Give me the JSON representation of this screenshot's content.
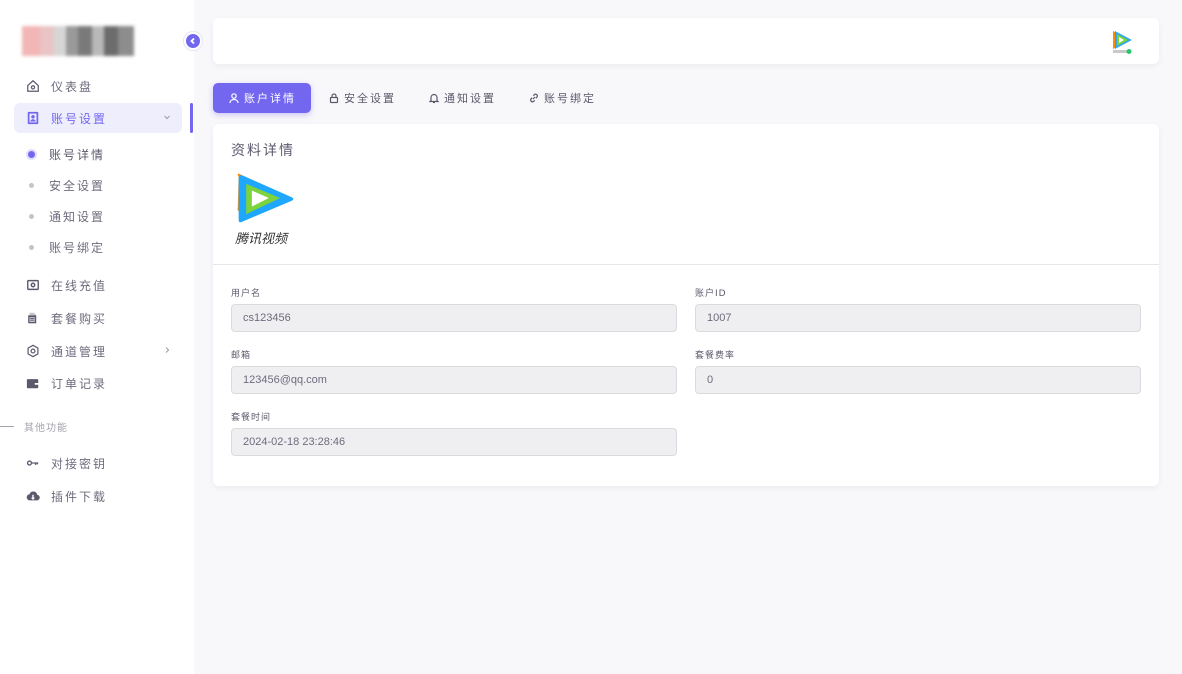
{
  "sidebar": {
    "nav": [
      {
        "label": "仪表盘",
        "icon": "home-icon"
      },
      {
        "label": "账号设置",
        "icon": "account-icon"
      },
      {
        "label": "在线充值",
        "icon": "recharge-icon"
      },
      {
        "label": "套餐购买",
        "icon": "package-icon"
      },
      {
        "label": "通道管理",
        "icon": "settings-icon"
      },
      {
        "label": "订单记录",
        "icon": "wallet-icon"
      }
    ],
    "sub": [
      {
        "label": "账号详情"
      },
      {
        "label": "安全设置"
      },
      {
        "label": "通知设置"
      },
      {
        "label": "账号绑定"
      }
    ],
    "section": "其他功能",
    "other": [
      {
        "label": "对接密钥",
        "icon": "key-icon"
      },
      {
        "label": "插件下载",
        "icon": "cloud-download-icon"
      }
    ]
  },
  "tabs": [
    {
      "label": "账户详情",
      "icon": "user-icon"
    },
    {
      "label": "安全设置",
      "icon": "lock-icon"
    },
    {
      "label": "通知设置",
      "icon": "bell-icon"
    },
    {
      "label": "账号绑定",
      "icon": "link-icon"
    }
  ],
  "card": {
    "title": "资料详情",
    "brand": "腾讯视频",
    "fields": {
      "username": {
        "label": "用户名",
        "value": "cs123456"
      },
      "account_id": {
        "label": "账户ID",
        "value": "1007"
      },
      "email": {
        "label": "邮箱",
        "value": "123456@qq.com"
      },
      "rate": {
        "label": "套餐费率",
        "value": "0"
      },
      "time": {
        "label": "套餐时间",
        "value": "2024-02-18 23:28:46"
      }
    }
  },
  "colors": {
    "accent": "#7367f0",
    "page_bg": "#f8f7fa",
    "text": "#5d596c"
  }
}
